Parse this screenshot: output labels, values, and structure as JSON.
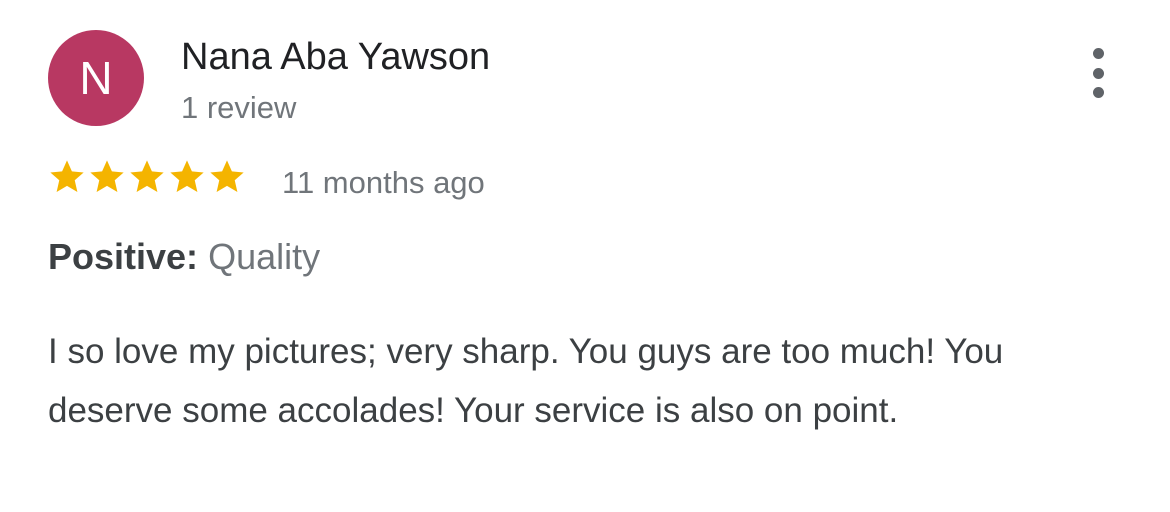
{
  "review": {
    "reviewer": {
      "initial": "N",
      "name": "Nana Aba Yawson",
      "review_count": "1 review",
      "avatar_color": "#b83862"
    },
    "more_options_icon": "more-vert-icon",
    "rating": {
      "stars": 5,
      "out_of": 5,
      "star_color": "#f4b400",
      "star_icon": "star-icon"
    },
    "date": "11 months ago",
    "highlight": {
      "label": "Positive:",
      "value": "Quality"
    },
    "text": "I so love my pictures; very sharp. You guys are too much! You deserve some accolades! Your service is also on point."
  }
}
